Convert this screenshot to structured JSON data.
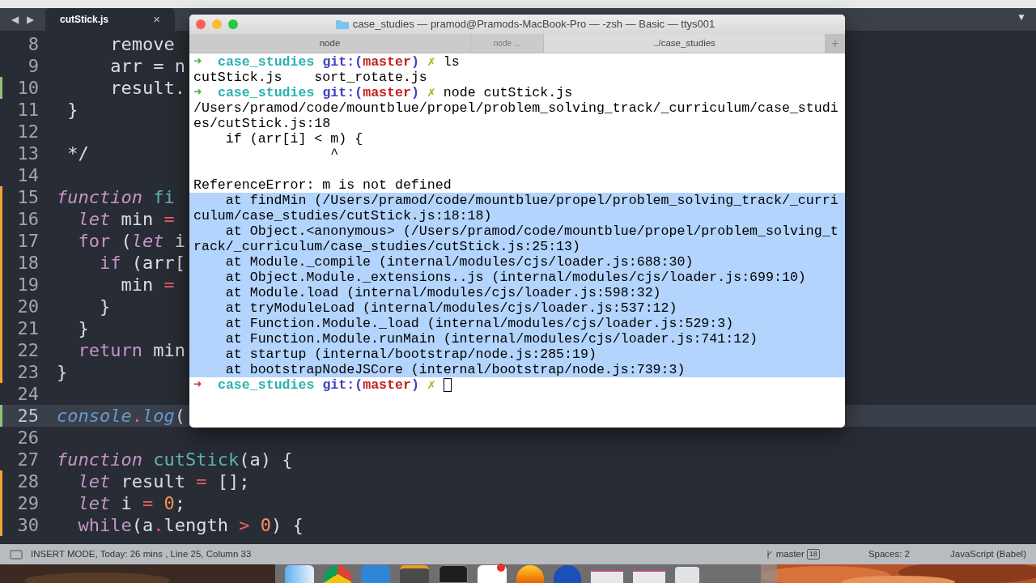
{
  "editor": {
    "nav": [
      "◀",
      "▶"
    ],
    "tabs": [
      {
        "label": "cutStick.js",
        "close": "×",
        "selected": true
      }
    ],
    "menu": "▼",
    "lines": [
      {
        "number": "8",
        "added": false,
        "modified": false,
        "current": false,
        "tokens": [
          {
            "text": "     remove",
            "kind": "plain"
          }
        ]
      },
      {
        "number": "9",
        "added": false,
        "modified": false,
        "current": false,
        "tokens": [
          {
            "text": "     arr = n",
            "kind": "plain"
          }
        ]
      },
      {
        "number": "10",
        "added": true,
        "modified": false,
        "current": false,
        "tokens": [
          {
            "text": "     result.",
            "kind": "plain"
          }
        ]
      },
      {
        "number": "11",
        "added": false,
        "modified": false,
        "current": false,
        "tokens": [
          {
            "text": " }",
            "kind": "plain"
          }
        ]
      },
      {
        "number": "12",
        "added": false,
        "modified": false,
        "current": false
      },
      {
        "number": "13",
        "added": false,
        "modified": false,
        "current": false,
        "tokens": [
          {
            "text": " */",
            "kind": "plain"
          }
        ]
      },
      {
        "number": "14",
        "added": false,
        "modified": false,
        "current": false
      },
      {
        "number": "15",
        "added": false,
        "modified": true,
        "current": false,
        "tokens": [
          {
            "text": "function",
            "kind": "keyword"
          },
          {
            "text": " fi",
            "kind": "name"
          }
        ]
      },
      {
        "number": "16",
        "added": false,
        "modified": true,
        "current": false,
        "tokens": [
          {
            "text": "  let",
            "kind": "keyword"
          },
          {
            "text": " min ",
            "kind": "plain"
          },
          {
            "text": "=",
            "kind": "operator"
          }
        ]
      },
      {
        "number": "17",
        "added": false,
        "modified": true,
        "current": false,
        "tokens": [
          {
            "text": "  for",
            "kind": "control"
          },
          {
            "text": " (",
            "kind": "plain"
          },
          {
            "text": "let",
            "kind": "keyword"
          },
          {
            "text": " i",
            "kind": "plain"
          }
        ]
      },
      {
        "number": "18",
        "added": false,
        "modified": true,
        "current": false,
        "tokens": [
          {
            "text": "    if",
            "kind": "control"
          },
          {
            "text": " (arr[",
            "kind": "plain"
          }
        ]
      },
      {
        "number": "19",
        "added": false,
        "modified": true,
        "current": false,
        "tokens": [
          {
            "text": "      min ",
            "kind": "plain"
          },
          {
            "text": "=",
            "kind": "operator"
          }
        ]
      },
      {
        "number": "20",
        "added": false,
        "modified": true,
        "current": false,
        "tokens": [
          {
            "text": "    }",
            "kind": "plain"
          }
        ]
      },
      {
        "number": "21",
        "added": false,
        "modified": true,
        "current": false,
        "tokens": [
          {
            "text": "  }",
            "kind": "plain"
          }
        ]
      },
      {
        "number": "22",
        "added": false,
        "modified": true,
        "current": false,
        "tokens": [
          {
            "text": "  return",
            "kind": "control"
          },
          {
            "text": " min",
            "kind": "plain"
          }
        ]
      },
      {
        "number": "23",
        "added": false,
        "modified": true,
        "current": false,
        "tokens": [
          {
            "text": "}",
            "kind": "plain"
          }
        ]
      },
      {
        "number": "24",
        "added": false,
        "modified": false,
        "current": false
      },
      {
        "number": "25",
        "added": true,
        "modified": false,
        "current": true,
        "tokens": [
          {
            "text": "console",
            "kind": "builtin"
          },
          {
            "text": ".",
            "kind": "operator"
          },
          {
            "text": "log",
            "kind": "builtin"
          },
          {
            "text": "(",
            "kind": "plain"
          }
        ]
      },
      {
        "number": "26",
        "added": false,
        "modified": false,
        "current": false
      },
      {
        "number": "27",
        "added": false,
        "modified": false,
        "current": false,
        "tokens": [
          {
            "text": "function",
            "kind": "keyword"
          },
          {
            "text": " cutStick",
            "kind": "name"
          },
          {
            "text": "(a) {",
            "kind": "plain"
          }
        ]
      },
      {
        "number": "28",
        "added": false,
        "modified": true,
        "current": false,
        "tokens": [
          {
            "text": "  let",
            "kind": "keyword"
          },
          {
            "text": " result ",
            "kind": "plain"
          },
          {
            "text": "=",
            "kind": "operator"
          },
          {
            "text": " [];",
            "kind": "plain"
          }
        ]
      },
      {
        "number": "29",
        "added": false,
        "modified": true,
        "current": false,
        "tokens": [
          {
            "text": "  let",
            "kind": "keyword"
          },
          {
            "text": " i ",
            "kind": "plain"
          },
          {
            "text": "=",
            "kind": "operator"
          },
          {
            "text": " 0",
            "kind": "number"
          },
          {
            "text": ";",
            "kind": "plain"
          }
        ]
      },
      {
        "number": "30",
        "added": false,
        "modified": true,
        "current": false,
        "tokens": [
          {
            "text": "  while",
            "kind": "control"
          },
          {
            "text": "(a",
            "kind": "plain"
          },
          {
            "text": ".",
            "kind": "operator"
          },
          {
            "text": "length ",
            "kind": "plain"
          },
          {
            "text": ">",
            "kind": "operator"
          },
          {
            "text": " 0",
            "kind": "number"
          },
          {
            "text": ") {",
            "kind": "plain"
          }
        ]
      }
    ]
  },
  "terminal": {
    "title": "case_studies — pramod@Pramods-MacBook-Pro — -zsh — Basic — ttys001",
    "tabs": [
      {
        "label": "node",
        "selected": false
      },
      {
        "label": "node ...",
        "selected": false
      },
      {
        "label": "../case_studies",
        "selected": true
      }
    ],
    "new_tab": "+",
    "lines": [
      {
        "kind": "prompt",
        "arrow": "➜",
        "error": false,
        "dir": "case_studies",
        "git": "git:(",
        "branch": "master",
        "git_end": ")",
        "dirty": "✗",
        "command": "ls",
        "cursor": false
      },
      {
        "kind": "output",
        "text": "cutStick.js    sort_rotate.js",
        "selected": false
      },
      {
        "kind": "prompt",
        "arrow": "➜",
        "error": false,
        "dir": "case_studies",
        "git": "git:(",
        "branch": "master",
        "git_end": ")",
        "dirty": "✗",
        "command": "node cutStick.js",
        "cursor": false
      },
      {
        "kind": "output",
        "text": "/Users/pramod/code/mountblue/propel/problem_solving_track/_curriculum/case_studi",
        "selected": false
      },
      {
        "kind": "output",
        "text": "es/cutStick.js:18",
        "selected": false
      },
      {
        "kind": "output",
        "text": "    if (arr[i] < m) {",
        "selected": false
      },
      {
        "kind": "output",
        "text": "                 ^",
        "selected": false
      },
      {
        "kind": "blank"
      },
      {
        "kind": "output",
        "text": "ReferenceError: m is not defined",
        "selected": false
      },
      {
        "kind": "output",
        "text": "    at findMin (/Users/pramod/code/mountblue/propel/problem_solving_track/_curri",
        "selected": true
      },
      {
        "kind": "output",
        "text": "culum/case_studies/cutStick.js:18:18)",
        "selected": true
      },
      {
        "kind": "output",
        "text": "    at Object.<anonymous> (/Users/pramod/code/mountblue/propel/problem_solving_t",
        "selected": true
      },
      {
        "kind": "output",
        "text": "rack/_curriculum/case_studies/cutStick.js:25:13)",
        "selected": true
      },
      {
        "kind": "output",
        "text": "    at Module._compile (internal/modules/cjs/loader.js:688:30)",
        "selected": true
      },
      {
        "kind": "output",
        "text": "    at Object.Module._extensions..js (internal/modules/cjs/loader.js:699:10)",
        "selected": true
      },
      {
        "kind": "output",
        "text": "    at Module.load (internal/modules/cjs/loader.js:598:32)",
        "selected": true
      },
      {
        "kind": "output",
        "text": "    at tryModuleLoad (internal/modules/cjs/loader.js:537:12)",
        "selected": true
      },
      {
        "kind": "output",
        "text": "    at Function.Module._load (internal/modules/cjs/loader.js:529:3)",
        "selected": true
      },
      {
        "kind": "output",
        "text": "    at Function.Module.runMain (internal/modules/cjs/loader.js:741:12)",
        "selected": true
      },
      {
        "kind": "output",
        "text": "    at startup (internal/bootstrap/node.js:285:19)",
        "selected": true
      },
      {
        "kind": "output",
        "text": "    at bootstrapNodeJSCore (internal/bootstrap/node.js:739:3)",
        "selected": true
      },
      {
        "kind": "prompt",
        "arrow": "➜",
        "error": true,
        "dir": "case_studies",
        "git": "git:(",
        "branch": "master",
        "git_end": ")",
        "dirty": "✗",
        "cursor": true
      }
    ]
  },
  "status_bar": {
    "mode": "INSERT MODE, Today: 26 mins , Line 25, Column 33",
    "branch": "master",
    "branch_count": "18",
    "spaces": "Spaces: 2",
    "syntax": "JavaScript (Babel)"
  },
  "dock": {
    "items": [
      {
        "kind": "finder"
      },
      {
        "kind": "chrome"
      },
      {
        "kind": "vscode"
      },
      {
        "kind": "sublime"
      },
      {
        "kind": "terminal"
      },
      {
        "kind": "slack"
      },
      {
        "kind": "firefox"
      },
      {
        "kind": "globe"
      },
      {
        "kind": "preview"
      },
      {
        "kind": "preview"
      },
      {
        "kind": "trash"
      }
    ]
  }
}
